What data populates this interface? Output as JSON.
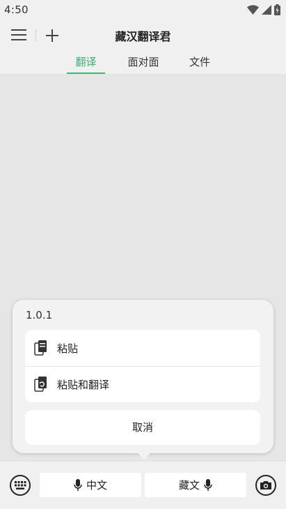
{
  "status_bar": {
    "time": "4:50"
  },
  "app_bar": {
    "title": "藏汉翻译君"
  },
  "tabs": [
    {
      "label": "翻译",
      "active": true
    },
    {
      "label": "面对面",
      "active": false
    },
    {
      "label": "文件",
      "active": false
    }
  ],
  "popup": {
    "version": "1.0.1",
    "items": [
      {
        "label": "粘贴",
        "icon": "paste-icon"
      },
      {
        "label": "粘贴和翻译",
        "icon": "paste-translate-icon"
      }
    ],
    "cancel_label": "取消"
  },
  "bottom_bar": {
    "source_lang": "中文",
    "target_lang": "藏文"
  },
  "colors": {
    "accent": "#3cb371",
    "background": "#e6e6e6"
  }
}
